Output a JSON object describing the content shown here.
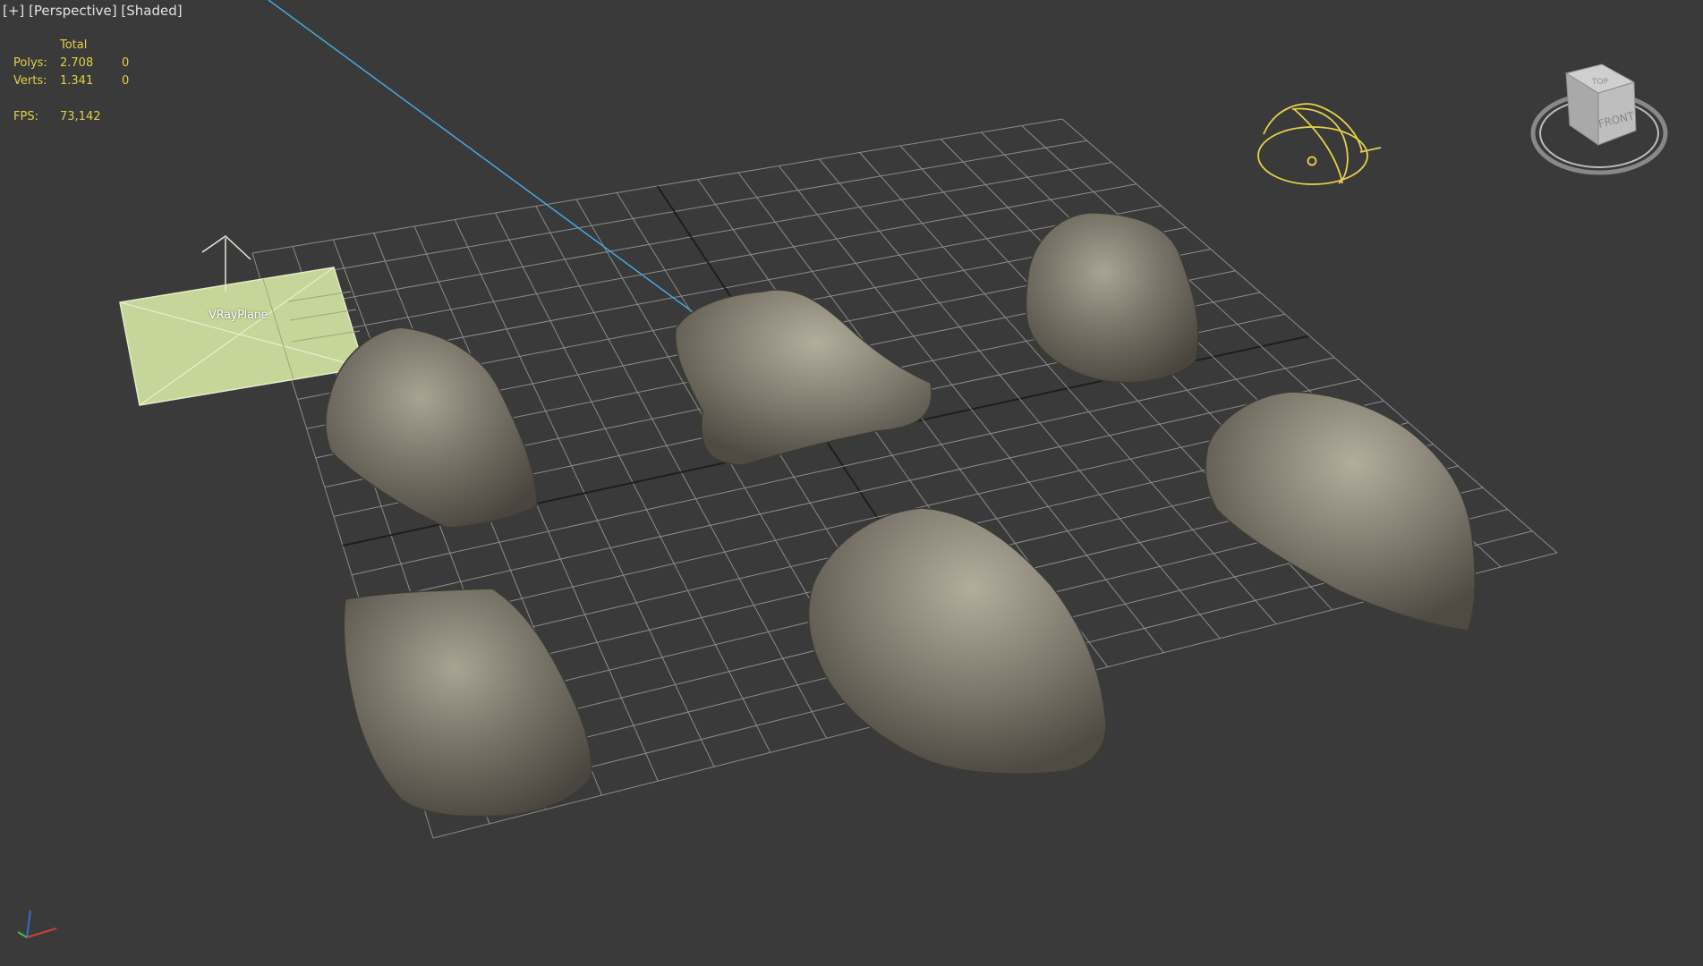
{
  "viewport": {
    "label_parts": [
      "[+]",
      "[Perspective]",
      "[Shaded]"
    ]
  },
  "stats": {
    "header": "Total",
    "rows": [
      {
        "label": "Polys:",
        "total": "2.708",
        "selected": "0"
      },
      {
        "label": "Verts:",
        "total": "1.341",
        "selected": "0"
      }
    ],
    "fps_label": "FPS:",
    "fps_value": "73,142"
  },
  "scene_objects": {
    "plane_name": "VRayPlane",
    "rock_count": 6
  },
  "viewcube": {
    "top": "TOP",
    "front": "FRONT"
  },
  "colors": {
    "background": "#3a3a3a",
    "grid": "#8c8c8c",
    "grid_axis": "#1e1e1e",
    "stats_text": "#e3cf4a",
    "light_gizmo": "#e8d24a",
    "plane_fill": "#c6d69a",
    "target_line": "#4aa6e0"
  }
}
